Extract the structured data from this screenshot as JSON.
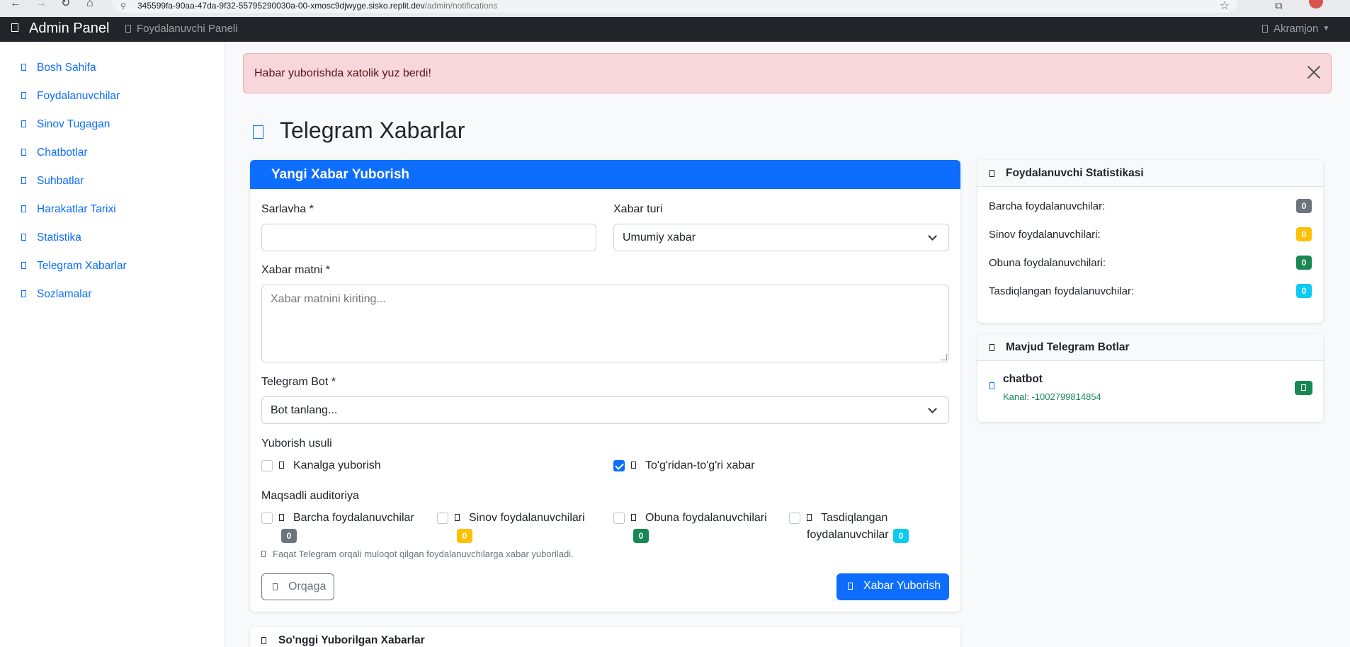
{
  "browser": {
    "url_host": "345599fa-90aa-47da-9f32-55795290030a-00-xmosc9djwyge.sisko.replit.dev",
    "url_path": "/admin/notifications"
  },
  "navbar": {
    "brand": "Admin Panel",
    "user_panel": "Foydalanuvchi Paneli",
    "account": "Akramjon"
  },
  "sidebar": {
    "items": [
      {
        "label": "Bosh Sahifa"
      },
      {
        "label": "Foydalanuvchilar"
      },
      {
        "label": "Sinov Tugagan"
      },
      {
        "label": "Chatbotlar"
      },
      {
        "label": "Suhbatlar"
      },
      {
        "label": "Harakatlar Tarixi"
      },
      {
        "label": "Statistika"
      },
      {
        "label": "Telegram Xabarlar"
      },
      {
        "label": "Sozlamalar"
      }
    ]
  },
  "alert": {
    "message": "Habar yuborishda xatolik yuz berdi!"
  },
  "page": {
    "title": "Telegram Xabarlar"
  },
  "form": {
    "header": "Yangi Xabar Yuborish",
    "title_label": "Sarlavha *",
    "title_value": "",
    "type_label": "Xabar turi",
    "type_value": "Umumiy xabar",
    "text_label": "Xabar matni *",
    "text_placeholder": "Xabar matnini kiriting...",
    "bot_label": "Telegram Bot *",
    "bot_value": "Bot tanlang...",
    "method_label": "Yuborish usuli",
    "method_options": [
      {
        "label": "Kanalga yuborish",
        "checked": false
      },
      {
        "label": "To'g'ridan-to'g'ri xabar",
        "checked": true
      }
    ],
    "audience_label": "Maqsadli auditoriya",
    "audience_options": [
      {
        "label": "Barcha foydalanuvchilar",
        "count": "0",
        "checked": false
      },
      {
        "label": "Sinov foydalanuvchilari",
        "count": "0",
        "checked": false
      },
      {
        "label": "Obuna foydalanuvchilari",
        "count": "0",
        "checked": false
      },
      {
        "label_line1": "Tasdiqlangan",
        "label_line2": "foydalanuvchilar",
        "count": "0",
        "checked": false
      }
    ],
    "hint": "Faqat Telegram orqali muloqot qilgan foydalanuvchilarga xabar yuboriladi.",
    "back_button": "Orqaga",
    "send_button": "Xabar Yuborish"
  },
  "stats": {
    "header": "Foydalanuvchi Statistikasi",
    "rows": [
      {
        "label": "Barcha foydalanuvchilar:",
        "value": "0"
      },
      {
        "label": "Sinov foydalanuvchilari:",
        "value": "0"
      },
      {
        "label": "Obuna foydalanuvchilari:",
        "value": "0"
      },
      {
        "label": "Tasdiqlangan foydalanuvchilar:",
        "value": "0"
      }
    ]
  },
  "bots": {
    "header": "Mavjud Telegram Botlar",
    "items": [
      {
        "name": "chatbot",
        "channel": "Kanal: -1002799814854"
      }
    ]
  },
  "recent": {
    "header": "So'nggi Yuborilgan Xabarlar"
  }
}
